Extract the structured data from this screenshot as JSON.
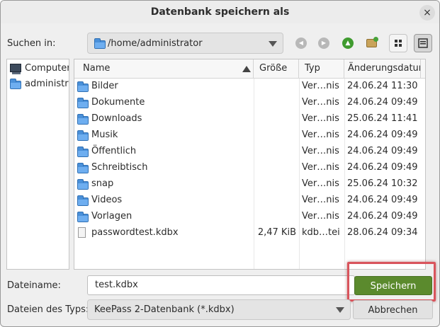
{
  "dialog": {
    "title": "Datenbank speichern als",
    "close_glyph": "×"
  },
  "location": {
    "label": "Suchen in:",
    "path": "/home/administrator"
  },
  "toolbar": {
    "back_glyph": "◀",
    "forward_glyph": "▶",
    "up_glyph": "▲",
    "icons": [
      "back-icon",
      "forward-icon",
      "up-icon",
      "new-folder-icon",
      "grid-view-icon",
      "list-view-icon"
    ]
  },
  "sidebar": {
    "items": [
      {
        "label": "Computer",
        "icon": "computer-icon"
      },
      {
        "label": "administra",
        "icon": "folder-icon"
      }
    ]
  },
  "filelist": {
    "columns": [
      "Name",
      "Größe",
      "Typ",
      "Änderungsdatun"
    ],
    "sort": "Name ascending",
    "rows": [
      {
        "name": "Bilder",
        "size": "",
        "type": "Ver…nis",
        "date": "24.06.24 11:30",
        "icon": "folder-icon"
      },
      {
        "name": "Dokumente",
        "size": "",
        "type": "Ver…nis",
        "date": "24.06.24 09:49",
        "icon": "folder-icon"
      },
      {
        "name": "Downloads",
        "size": "",
        "type": "Ver…nis",
        "date": "25.06.24 11:41",
        "icon": "folder-icon"
      },
      {
        "name": "Musik",
        "size": "",
        "type": "Ver…nis",
        "date": "24.06.24 09:49",
        "icon": "folder-icon"
      },
      {
        "name": "Öffentlich",
        "size": "",
        "type": "Ver…nis",
        "date": "24.06.24 09:49",
        "icon": "folder-icon"
      },
      {
        "name": "Schreibtisch",
        "size": "",
        "type": "Ver…nis",
        "date": "24.06.24 09:49",
        "icon": "folder-icon"
      },
      {
        "name": "snap",
        "size": "",
        "type": "Ver…nis",
        "date": "25.06.24 10:32",
        "icon": "folder-icon"
      },
      {
        "name": "Videos",
        "size": "",
        "type": "Ver…nis",
        "date": "24.06.24 09:49",
        "icon": "folder-icon"
      },
      {
        "name": "Vorlagen",
        "size": "",
        "type": "Ver…nis",
        "date": "24.06.24 09:49",
        "icon": "folder-icon"
      },
      {
        "name": "passwordtest.kdbx",
        "size": "2,47 KiB",
        "type": "kdb…tei",
        "date": "28.06.24 09:34",
        "icon": "file-icon"
      }
    ]
  },
  "filename": {
    "label": "Dateiname:",
    "value": "test.kdbx"
  },
  "filetype": {
    "label": "Dateien des Typs:",
    "value": "KeePass 2-Datenbank (*.kdbx)"
  },
  "buttons": {
    "save": "Speichern",
    "cancel": "Abbrechen"
  },
  "colors": {
    "save_button": "#5b8a2d",
    "folder": "#4a90d9",
    "highlight": "#d9545c",
    "up_button": "#3f9b2f"
  }
}
